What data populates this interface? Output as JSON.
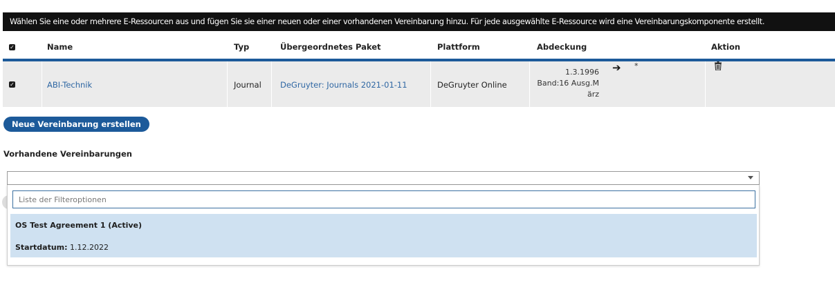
{
  "info_text": "Wählen Sie eine oder mehrere E-Ressourcen aus und fügen Sie sie einer neuen oder einer vorhandenen Vereinbarung hinzu. Für jede ausgewählte E-Ressource wird eine Vereinbarungskomponente erstellt.",
  "table": {
    "headers": {
      "name": "Name",
      "typ": "Typ",
      "paket": "Übergeordnetes Paket",
      "plattform": "Plattform",
      "abdeckung": "Abdeckung",
      "aktion": "Aktion"
    },
    "rows": [
      {
        "selected": true,
        "name": "ABI-Technik",
        "typ": "Journal",
        "paket": "DeGruyter: Journals 2021-01-11",
        "plattform": "DeGruyter Online",
        "coverage_start_line1": "1.3.1996",
        "coverage_start_line2": "Band:16 Ausg.M",
        "coverage_start_line3": "ärz",
        "coverage_end": "*"
      }
    ]
  },
  "new_agreement_button": "Neue Vereinbarung erstellen",
  "existing_label": "Vorhandene Vereinbarungen",
  "select": {
    "value": "",
    "filter_placeholder": "Liste der Filteroptionen",
    "option_name": "OS Test Agreement 1 (Active)",
    "option_start_label": "Startdatum:",
    "option_start_value": "1.12.2022"
  },
  "colors": {
    "accent": "#1c5a9a",
    "link": "#2f67a3",
    "info_bar": "#111111",
    "row_bg": "#ebebeb",
    "option_highlight": "#cfe1f1"
  }
}
